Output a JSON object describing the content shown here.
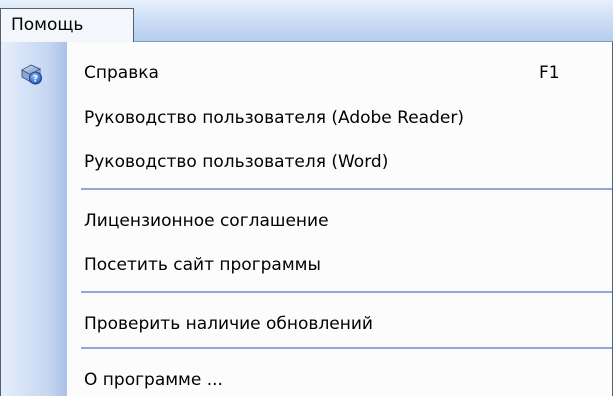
{
  "menubar": {
    "title": "Помощь"
  },
  "menu": {
    "items": [
      {
        "label": "Справка",
        "shortcut": "F1",
        "icon": "help-icon"
      },
      {
        "label": "Руководство пользователя (Adobe Reader)"
      },
      {
        "label": "Руководство пользователя (Word)"
      },
      {
        "label": "Лицензионное соглашение"
      },
      {
        "label": "Посетить сайт программы"
      },
      {
        "label": "Проверить наличие обновлений"
      },
      {
        "label": "О программе ..."
      }
    ]
  },
  "colors": {
    "gutter": "#c6d7f2",
    "separator": "#8fa9d6",
    "menubar": "#c9dbf5"
  }
}
